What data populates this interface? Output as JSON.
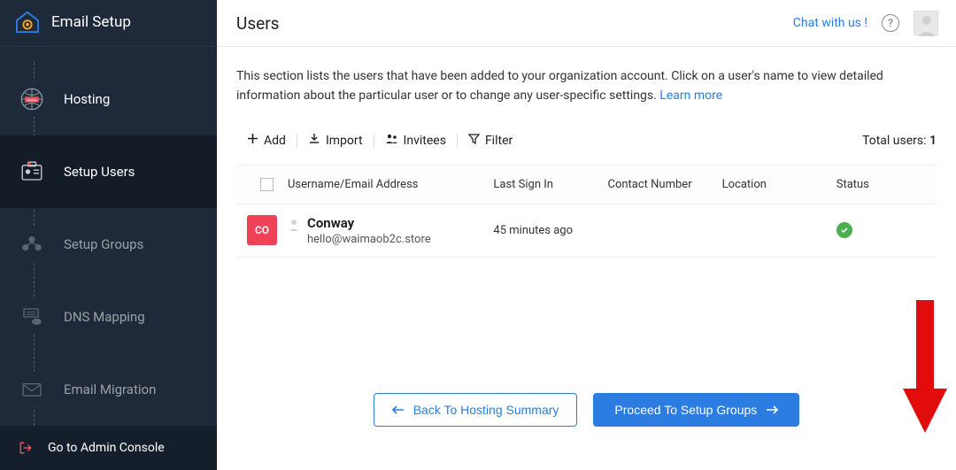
{
  "sidebar": {
    "title": "Email Setup",
    "items": [
      {
        "label": "Hosting",
        "state": "completed"
      },
      {
        "label": "Setup Users",
        "state": "active"
      },
      {
        "label": "Setup Groups",
        "state": "pending"
      },
      {
        "label": "DNS Mapping",
        "state": "pending"
      },
      {
        "label": "Email Migration",
        "state": "pending"
      }
    ],
    "admin_link": "Go to Admin Console"
  },
  "header": {
    "page_title": "Users",
    "chat_label": "Chat with us !",
    "help_symbol": "?"
  },
  "intro": {
    "text": "This section lists the users that have been added to your organization account. Click on a user's name to view detailed information about the particular user or to change any user-specific settings. ",
    "learn_more": "Learn more"
  },
  "toolbar": {
    "add": "Add",
    "import": "Import",
    "invitees": "Invitees",
    "filter": "Filter",
    "total_label": "Total users: ",
    "total_count": "1"
  },
  "columns": {
    "username": "Username/Email Address",
    "last_sign_in": "Last Sign In",
    "contact": "Contact Number",
    "location": "Location",
    "status": "Status"
  },
  "rows": [
    {
      "initials": "CO",
      "name": "Conway",
      "email": "hello@waimaob2c.store",
      "last_sign": "45 minutes ago",
      "contact": "",
      "location": "",
      "status": "active"
    }
  ],
  "footer": {
    "back": "Back To Hosting Summary",
    "proceed": "Proceed To Setup Groups"
  },
  "annotation": {
    "arrow_color": "#e30c0c"
  }
}
